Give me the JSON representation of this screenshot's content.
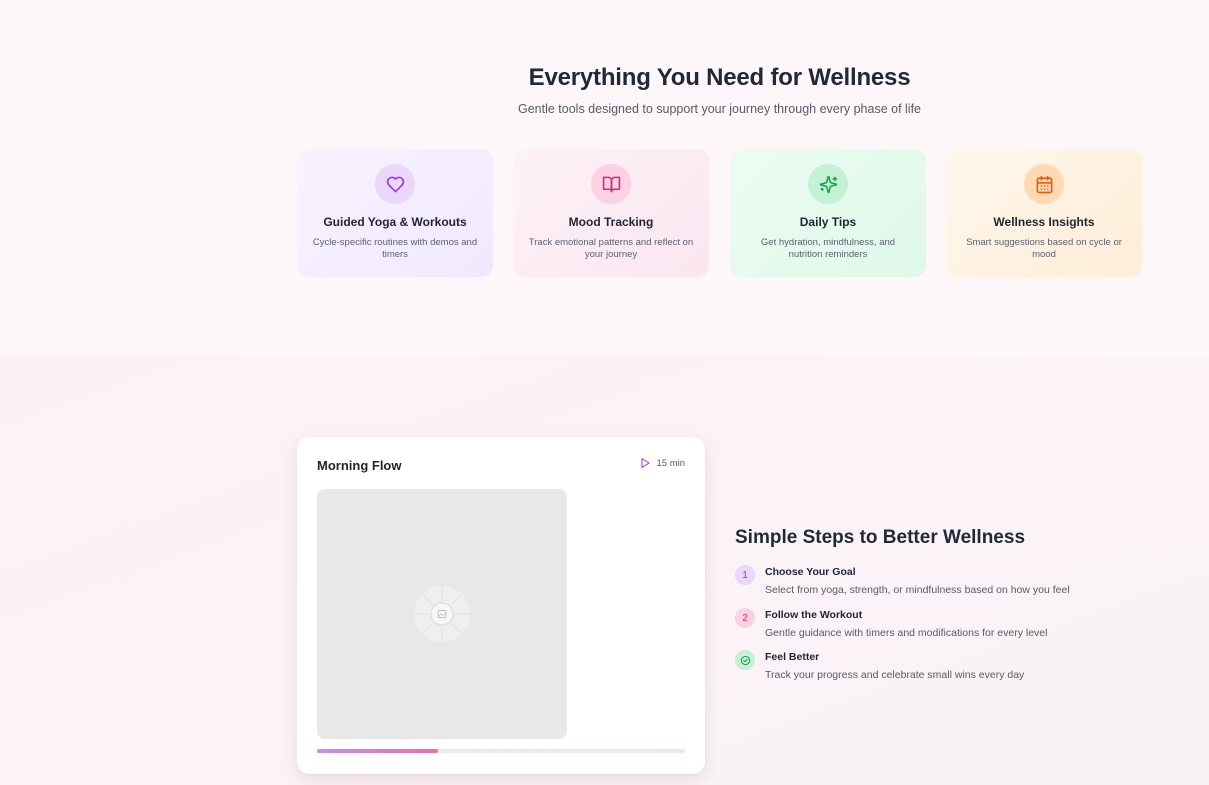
{
  "features": {
    "title": "Everything You Need for Wellness",
    "subtitle": "Gentle tools designed to support your journey through every phase of life",
    "cards": [
      {
        "title": "Guided Yoga & Workouts",
        "description": "Cycle-specific routines with demos and timers",
        "icon": "heart-icon",
        "accent": "#9333ea"
      },
      {
        "title": "Mood Tracking",
        "description": "Track emotional patterns and reflect on your journey",
        "icon": "book-open-icon",
        "accent": "#db2777"
      },
      {
        "title": "Daily Tips",
        "description": "Get hydration, mindfulness, and nutrition reminders",
        "icon": "sparkles-icon",
        "accent": "#16a34a"
      },
      {
        "title": "Wellness Insights",
        "description": "Smart suggestions based on cycle or mood",
        "icon": "calendar-icon",
        "accent": "#ea580c"
      }
    ]
  },
  "player": {
    "title": "Morning Flow",
    "duration": "15 min",
    "icon": "play-icon",
    "progress": 0.33
  },
  "steps": {
    "title": "Simple Steps to Better Wellness",
    "items": [
      {
        "number": "1",
        "title": "Choose Your Goal",
        "description": "Select from yoga, strength, or mindfulness based on how you feel"
      },
      {
        "number": "2",
        "title": "Follow the Workout",
        "description": "Gentle guidance with timers and modifications for every level"
      },
      {
        "number": "",
        "icon": "check-circle-icon",
        "title": "Feel Better",
        "description": "Track your progress and celebrate small wins every day"
      }
    ]
  }
}
